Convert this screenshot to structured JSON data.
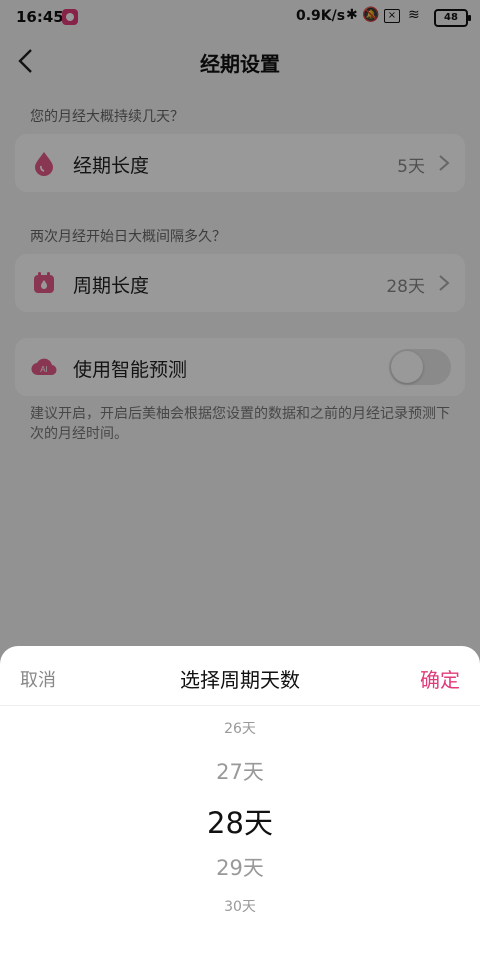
{
  "status": {
    "time": "16:45",
    "speed": "0.9K/s",
    "battery": "48"
  },
  "header": {
    "title": "经期设置"
  },
  "period": {
    "question": "您的月经大概持续几天？",
    "label": "经期长度",
    "value": "5天"
  },
  "cycle": {
    "question": "两次月经开始日大概间隔多久？",
    "label": "周期长度",
    "value": "28天"
  },
  "smart": {
    "label": "使用智能预测",
    "icon_text": "AI",
    "enabled": false
  },
  "hint": "建议开启，开启后美柚会根据您设置的数据和之前的月经记录预测下次的月经时间。",
  "sheet": {
    "cancel": "取消",
    "title": "选择周期天数",
    "confirm": "确定",
    "options": [
      "26天",
      "27天",
      "28天",
      "29天",
      "30天"
    ],
    "selected": "28天"
  },
  "colors": {
    "accent": "#e23a7a",
    "icon_pink": "#e55a8a"
  }
}
